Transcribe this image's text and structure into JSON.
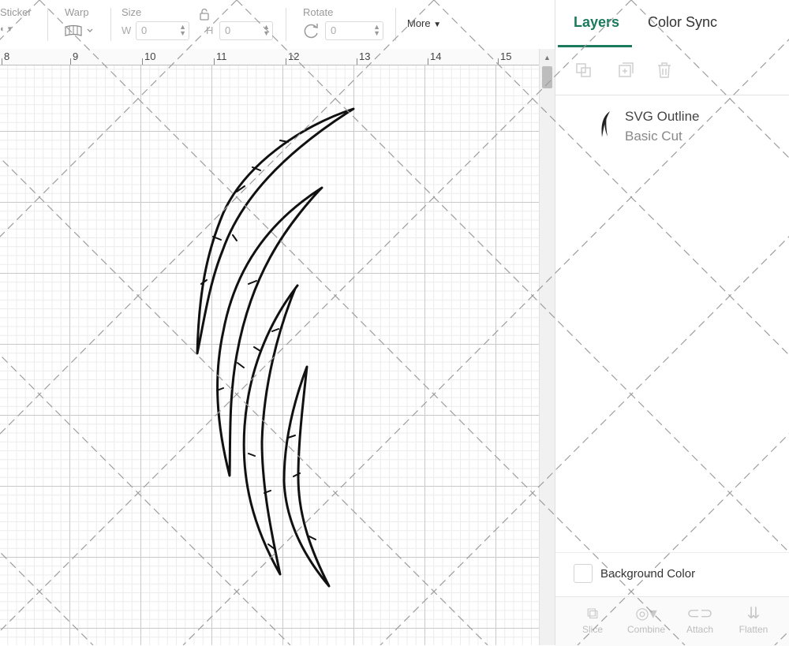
{
  "toolbar": {
    "sticker_label": "Sticker",
    "warp_label": "Warp",
    "size_label": "Size",
    "width_prefix": "W",
    "width_value": "0",
    "height_prefix": "H",
    "height_value": "0",
    "rotate_label": "Rotate",
    "rotate_value": "0",
    "more_label": "More"
  },
  "ruler": {
    "ticks": [
      "8",
      "9",
      "10",
      "11",
      "12",
      "13",
      "14",
      "15"
    ]
  },
  "panel": {
    "tabs": [
      {
        "label": "Layers",
        "active": true
      },
      {
        "label": "Color Sync",
        "active": false
      }
    ],
    "layer": {
      "name": "SVG Outline",
      "operation": "Basic Cut"
    },
    "background_color_label": "Background Color",
    "bottom_actions": [
      "Slice",
      "Combine",
      "Attach",
      "Flatten"
    ]
  },
  "colors": {
    "accent": "#1b7a5c",
    "shape_stroke": "#111111"
  },
  "icons": {
    "warp": "warp-icon",
    "lock": "lock-icon",
    "rotate": "rotate-icon",
    "layer_thumb": "claw-thumbnail-icon"
  }
}
